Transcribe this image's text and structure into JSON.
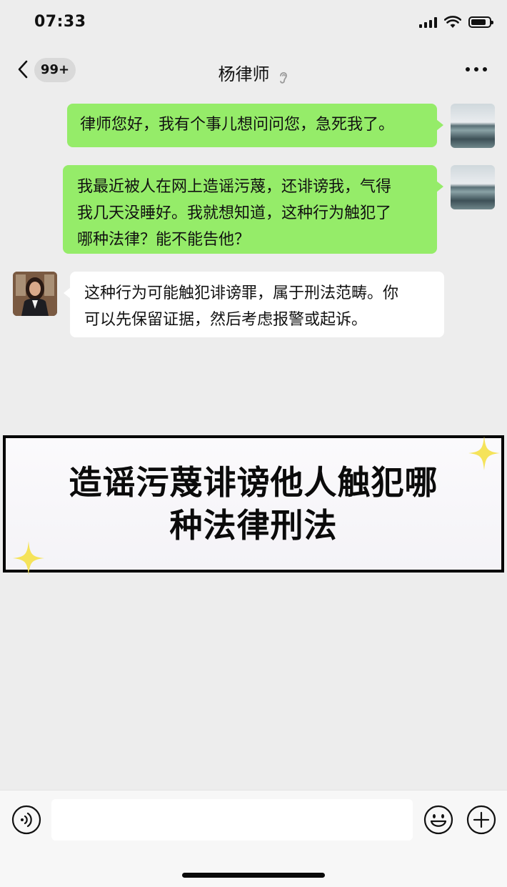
{
  "status_bar": {
    "time": "07:33",
    "battery_level": 0.85
  },
  "header": {
    "unread_badge": "99+",
    "title": "杨律师",
    "ear_icon": "ear-icon",
    "more_icon": "more-dots-icon"
  },
  "messages": [
    {
      "sender": "me",
      "text": "律师您好，我有个事儿想问问您，急死我了。"
    },
    {
      "sender": "me",
      "lines": [
        "我最近被人在网上造谣污蔑，还诽谤我，气得",
        "我几天没睡好。我就想知道，这种行为触犯了",
        "哪种法律？能不能告他？"
      ]
    },
    {
      "sender": "lawyer",
      "lines": [
        "这种行为可能触犯诽谤罪，属于刑法范畴。你",
        "可以先保留证据，然后考虑报警或起诉。"
      ]
    }
  ],
  "banner": {
    "line1": "造谣污蔑诽谤他人触犯哪",
    "line2": "种法律刑法"
  },
  "input_bar": {
    "voice_icon": "voice-icon",
    "input_value": "",
    "emoji_icon": "emoji-icon",
    "plus_icon": "plus-icon"
  },
  "colors": {
    "background": "#ededed",
    "outgoing_bubble": "#95ec69",
    "incoming_bubble": "#ffffff",
    "banner_border": "#000000",
    "sparkle": "#f5e35a"
  }
}
